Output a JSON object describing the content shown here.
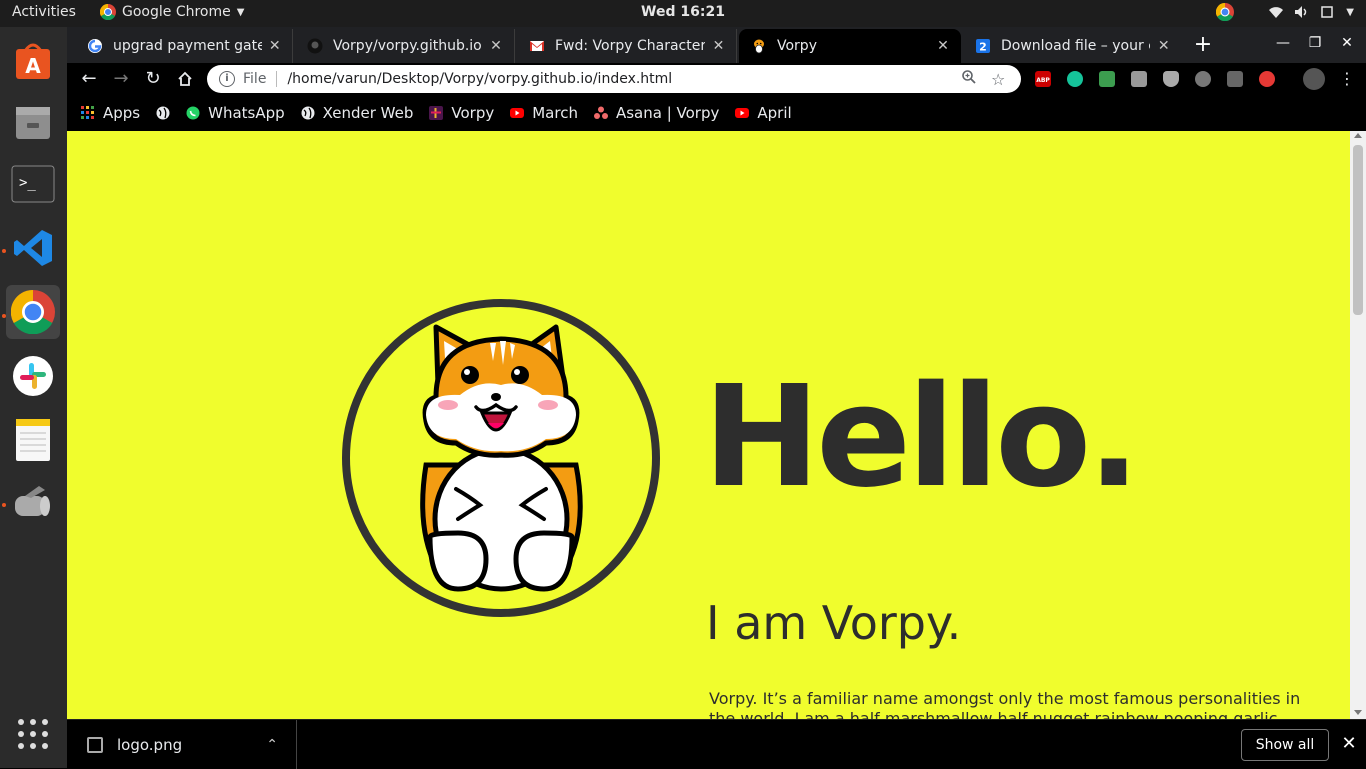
{
  "system": {
    "activities": "Activities",
    "app_name": "Google Chrome",
    "clock": "Wed 16:21"
  },
  "tabs": [
    {
      "title": "upgrad payment gatew",
      "icon": "google-icon"
    },
    {
      "title": "Vorpy/vorpy.github.io",
      "icon": "github-icon"
    },
    {
      "title": "Fwd: Vorpy Character -",
      "icon": "gmail-icon"
    },
    {
      "title": "Vorpy",
      "icon": "vorpy-icon",
      "active": true
    },
    {
      "title": "Download file – your co",
      "icon": "download-site-icon"
    }
  ],
  "omnibox": {
    "scheme": "File",
    "url": "/home/varun/Desktop/Vorpy/vorpy.github.io/index.html"
  },
  "bookmarks": [
    {
      "label": "Apps",
      "icon": "apps-grid-icon"
    },
    {
      "label": "",
      "icon": "globe-icon"
    },
    {
      "label": "WhatsApp",
      "icon": "whatsapp-icon"
    },
    {
      "label": "Xender Web",
      "icon": "globe-icon"
    },
    {
      "label": "Vorpy",
      "icon": "slack-icon"
    },
    {
      "label": "March",
      "icon": "youtube-icon"
    },
    {
      "label": "Asana | Vorpy",
      "icon": "asana-icon"
    },
    {
      "label": "April",
      "icon": "youtube-icon"
    }
  ],
  "page": {
    "background": "#f0fd2d",
    "heading": "Hello.",
    "subheading": "I am Vorpy.",
    "paragraph": "Vorpy. It’s a familiar name amongst only the most famous personalities in the world. I am a half marshmallow half nugget rainbow pooping garlic"
  },
  "download_shelf": {
    "file": "logo.png",
    "show_all": "Show all"
  }
}
